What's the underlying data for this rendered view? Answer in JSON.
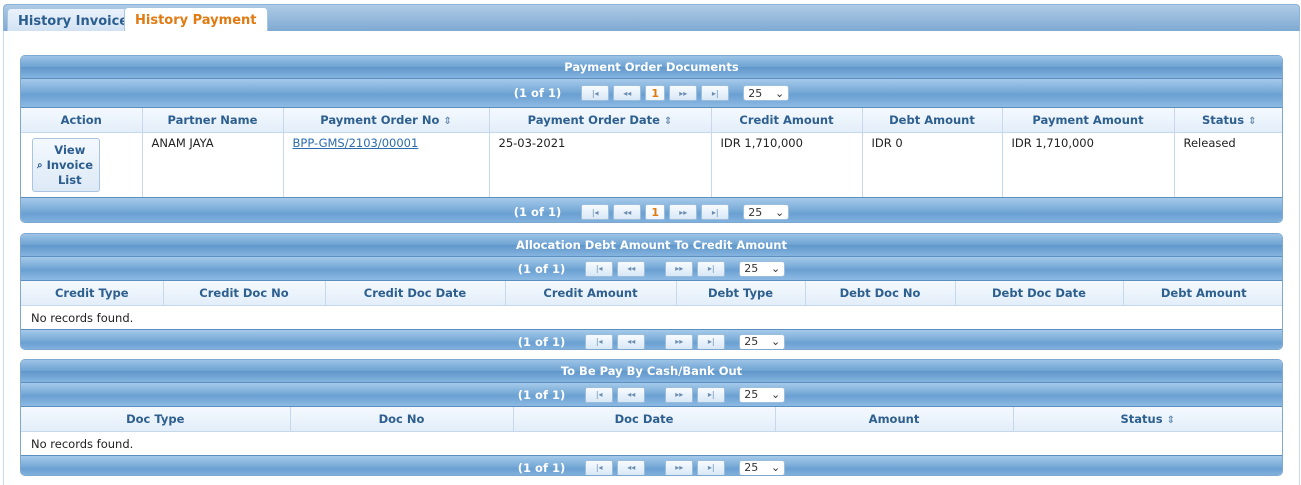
{
  "tabs": [
    {
      "label": "History Invoice",
      "active": false
    },
    {
      "label": "History Payment",
      "active": true
    }
  ],
  "pager_icons": {
    "first": "|◂",
    "prev": "◂◂",
    "next": "▸▸",
    "last": "▸|"
  },
  "panels": {
    "payment_orders": {
      "title": "Payment Order Documents",
      "pager": {
        "count": "(1 of 1)",
        "page": "1",
        "rows": "25"
      },
      "columns": [
        "Action",
        "Partner Name",
        "Payment Order No",
        "Payment Order Date",
        "Credit Amount",
        "Debt Amount",
        "Payment Amount",
        "Status"
      ],
      "rows": [
        {
          "action": "View Invoice List",
          "partner": "ANAM JAYA",
          "po_no": "BPP-GMS/2103/00001",
          "po_date": "25-03-2021",
          "credit": "IDR 1,710,000",
          "debt": "IDR 0",
          "payment": "IDR 1,710,000",
          "status": "Released"
        }
      ]
    },
    "allocation": {
      "title": "Allocation Debt Amount To Credit Amount",
      "pager": {
        "count": "(1 of 1)",
        "rows": "25"
      },
      "columns": [
        "Credit Type",
        "Credit Doc No",
        "Credit Doc Date",
        "Credit Amount",
        "Debt Type",
        "Debt Doc No",
        "Debt Doc Date",
        "Debt Amount"
      ],
      "empty": "No records found."
    },
    "cash_bank": {
      "title": "To Be Pay By Cash/Bank Out",
      "pager": {
        "count": "(1 of 1)",
        "rows": "25"
      },
      "columns": [
        "Doc Type",
        "Doc No",
        "Doc Date",
        "Amount",
        "Status"
      ],
      "empty": "No records found."
    }
  },
  "colors": {
    "accent_orange": "#e07a12",
    "header_blue": "#6ea2d2",
    "link_blue": "#2b6cae"
  }
}
